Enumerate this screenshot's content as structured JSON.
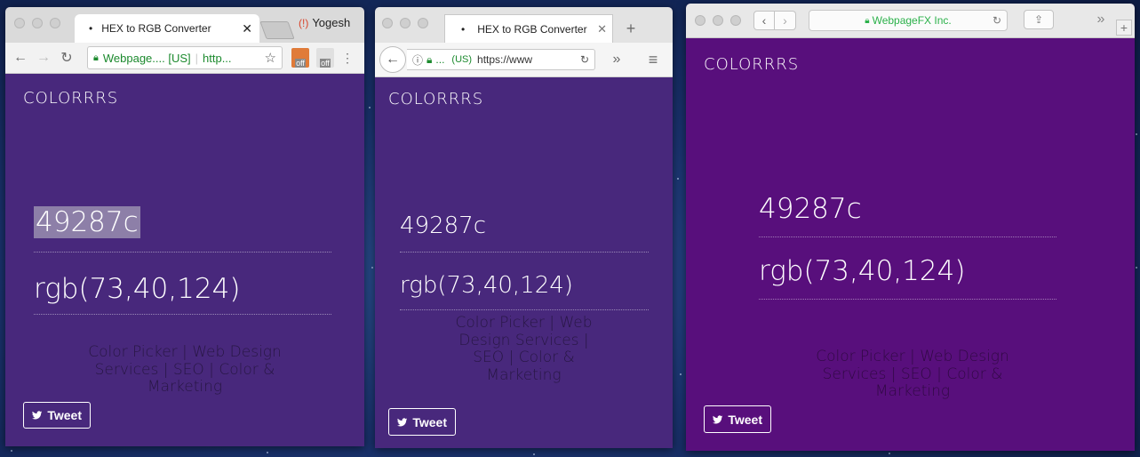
{
  "colors": {
    "win1_bg": "#48287c",
    "win2_bg": "#48287c",
    "win3_bg": "#580f7c",
    "accent_green": "#1c8a2e"
  },
  "window1": {
    "browser": "chrome",
    "tab_title": "HEX to RGB Converter",
    "profile_name": "Yogesh",
    "address_site": "Webpage.... [US]",
    "address_url": "http...",
    "ext_badge_1": "off",
    "ext_badge_2": "off",
    "brand": "COLORRRS",
    "hex_value": "49287c",
    "rgb_value": "rgb(73,40,124)",
    "links": [
      "Color Picker",
      "Web Design Services",
      "SEO",
      "Color & Marketing"
    ],
    "tweet_label": "Tweet"
  },
  "window2": {
    "browser": "firefox",
    "tab_title": "HEX to RGB Converter",
    "address_site": "...",
    "address_country": "(US)",
    "address_url": "https://www",
    "brand": "COLORRRS",
    "hex_value": "49287c",
    "rgb_value": "rgb(73,40,124)",
    "links": [
      "Color Picker",
      "Web Design Services",
      "SEO",
      "Color & Marketing"
    ],
    "tweet_label": "Tweet"
  },
  "window3": {
    "browser": "safari",
    "address_site": "WebpageFX Inc.",
    "brand": "COLORRRS",
    "hex_value": "49287c",
    "rgb_value": "rgb(73,40,124)",
    "links": [
      "Color Picker",
      "Web Design Services",
      "SEO",
      "Color & Marketing"
    ],
    "tweet_label": "Tweet"
  }
}
